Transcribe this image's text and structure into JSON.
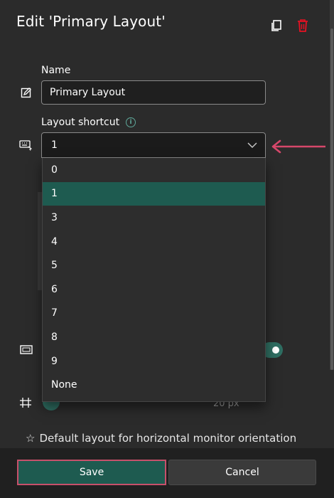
{
  "dialog": {
    "title": "Edit 'Primary Layout'"
  },
  "fields": {
    "name_label": "Name",
    "name_value": "Primary Layout",
    "shortcut_label": "Layout shortcut",
    "shortcut_selected": "1"
  },
  "shortcut_options": [
    "0",
    "1",
    "3",
    "4",
    "5",
    "6",
    "7",
    "8",
    "9",
    "None"
  ],
  "background": {
    "spacing_value": "20 px",
    "default_layout_text": "Default layout for horizontal monitor orientation"
  },
  "footer": {
    "save_label": "Save",
    "cancel_label": "Cancel"
  },
  "icons": {
    "copy": "copy-icon",
    "delete": "trash-icon",
    "edit": "edit-icon",
    "keyboard": "keyboard-icon",
    "info": "info-icon",
    "monitor": "monitor-icon",
    "spacing": "spacing-icon",
    "star": "star-icon"
  },
  "colors": {
    "accent": "#1e5b50",
    "delete": "#e81123",
    "annotation": "#d6476a"
  }
}
